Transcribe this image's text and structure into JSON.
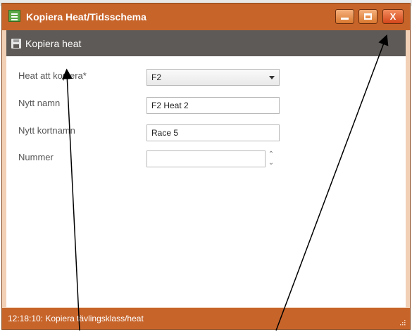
{
  "window": {
    "title": "Kopiera Heat/Tidsschema",
    "controls": {
      "minimize_icon": "minimize-icon",
      "maximize_icon": "maximize-icon",
      "close_glyph": "X"
    }
  },
  "toolbar": {
    "icon": "save-icon",
    "label": "Kopiera heat"
  },
  "form": {
    "heat": {
      "label": "Heat att kopiera*",
      "value": "F2"
    },
    "new_name": {
      "label": "Nytt namn",
      "value": "F2 Heat 2"
    },
    "new_short_name": {
      "label": "Nytt kortnamn",
      "value": "Race 5"
    },
    "number": {
      "label": "Nummer",
      "value": ""
    }
  },
  "statusbar": {
    "text": "12:18:10: Kopiera tävlingsklass/heat"
  },
  "colors": {
    "accent": "#c7642a",
    "toolbar": "#5e5a57",
    "window_bg": "#f1d0b6"
  }
}
